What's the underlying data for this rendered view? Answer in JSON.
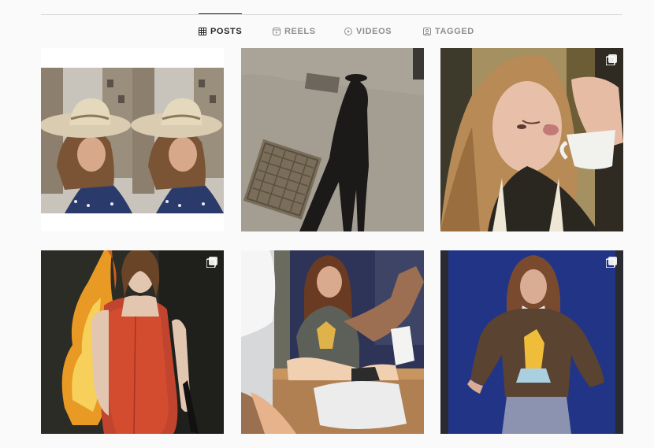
{
  "tabs": [
    {
      "label": "POSTS",
      "icon": "grid-icon",
      "active": true
    },
    {
      "label": "REELS",
      "icon": "reels-icon",
      "active": false
    },
    {
      "label": "VIDEOS",
      "icon": "video-icon",
      "active": false
    },
    {
      "label": "TAGGED",
      "icon": "tagged-icon",
      "active": false
    }
  ],
  "colors": {
    "background": "#fafafa",
    "tab_active": "#262626",
    "tab_inactive": "#8e8e8e",
    "divider": "#dbdbdb"
  },
  "posts": [
    {
      "subject": "girl-in-cowboy-hat-collage",
      "multi": false
    },
    {
      "subject": "shadow-on-pavement",
      "multi": false
    },
    {
      "subject": "girl-with-coffee-cup",
      "multi": true
    },
    {
      "subject": "red-dress-with-fire",
      "multi": true
    },
    {
      "subject": "girl-sitting-on-bench",
      "multi": false
    },
    {
      "subject": "girl-in-brown-sweater",
      "multi": true
    }
  ]
}
